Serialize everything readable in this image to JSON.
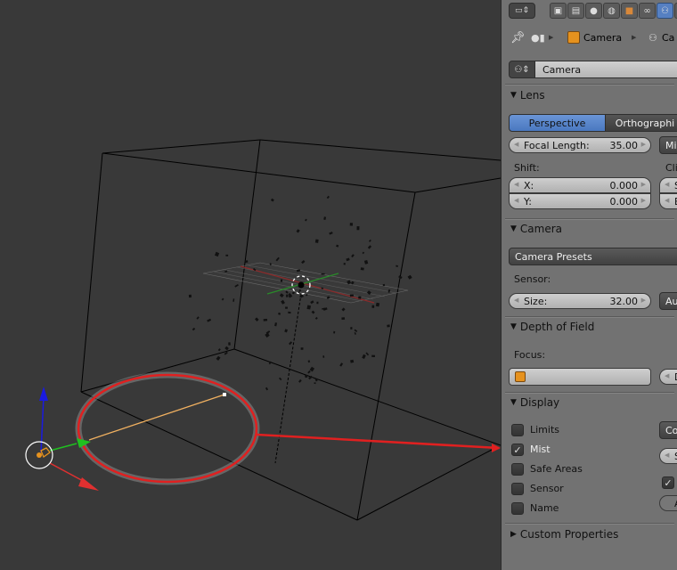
{
  "viewport": {
    "scene": "3D viewport with a wireframe cube, particle cloud, grid plane, 3D cursor and a camera object with its clip/mist line highlighted by a red annotation ellipse and arrow pointing to the Mist checkbox",
    "colors": {
      "background": "#393939",
      "annotation": "#e02020",
      "axis_x": "#e03030",
      "axis_y": "#20c020",
      "axis_z": "#1a1ae0",
      "mist_line": "#f0b060"
    }
  },
  "header": {
    "context_tabs": [
      {
        "icon": "render-icon",
        "active": false
      },
      {
        "icon": "render-layers-icon",
        "active": false
      },
      {
        "icon": "scene-icon",
        "active": false
      },
      {
        "icon": "world-icon",
        "active": false
      },
      {
        "icon": "object-icon",
        "active": false
      },
      {
        "icon": "constraints-icon",
        "active": false
      },
      {
        "icon": "camera-data-icon",
        "active": true
      },
      {
        "icon": "texture-icon",
        "active": false
      }
    ]
  },
  "breadcrumb": {
    "items": [
      "Camera",
      "Ca"
    ]
  },
  "datablock": {
    "name": "Camera"
  },
  "lens": {
    "title": "Lens",
    "projection_options": [
      "Perspective",
      "Orthographi"
    ],
    "projection_selected": "Perspective",
    "focal_length_label": "Focal Length:",
    "focal_length_value": "35.00",
    "units_button": "Mi",
    "shift_label": "Shift:",
    "shift_x_label": "X:",
    "shift_x_value": "0.000",
    "shift_y_label": "Y:",
    "shift_y_value": "0.000",
    "clipping_label": "Cli",
    "clip_start_label": "S",
    "clip_end_label": "E"
  },
  "camera": {
    "title": "Camera",
    "presets_label": "Camera Presets",
    "sensor_label": "Sensor:",
    "size_label": "Size:",
    "size_value": "32.00",
    "fit_button": "Au"
  },
  "dof": {
    "title": "Depth of Field",
    "focus_label": "Focus:",
    "focus_object": "",
    "distance_label": "D"
  },
  "display": {
    "title": "Display",
    "checkboxes": [
      {
        "label": "Limits",
        "checked": false
      },
      {
        "label": "Mist",
        "checked": true
      },
      {
        "label": "Safe Areas",
        "checked": false
      },
      {
        "label": "Sensor",
        "checked": false
      },
      {
        "label": "Name",
        "checked": false
      }
    ],
    "composition_button": "Co",
    "size_field_label": "S",
    "right_checkbox_checked": true,
    "alpha_field_label": "A"
  },
  "custom_properties": {
    "title": "Custom Properties"
  }
}
